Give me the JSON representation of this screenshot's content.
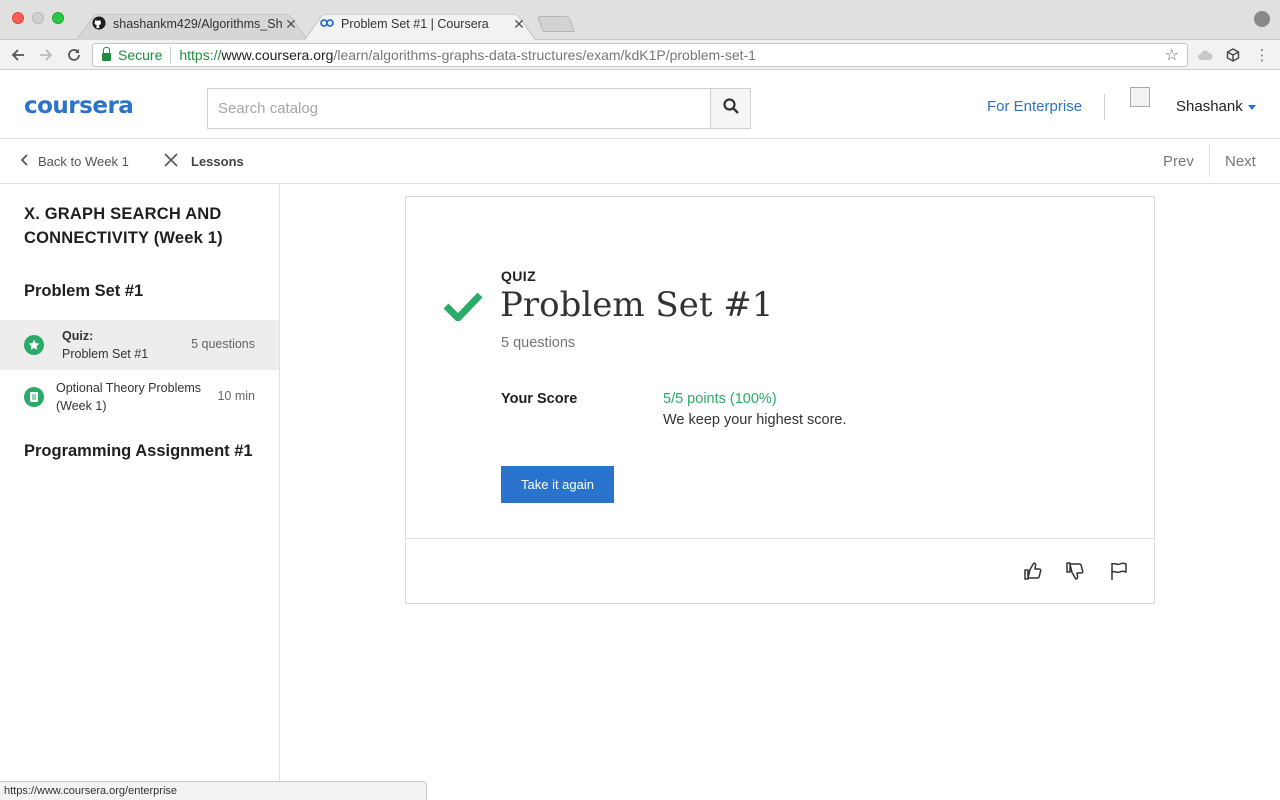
{
  "browser": {
    "tabs": [
      {
        "title": "shashankm429/Algorithms_Sh",
        "active": false
      },
      {
        "title": "Problem Set #1 | Coursera",
        "active": true
      }
    ],
    "address": {
      "secure_label": "Secure",
      "scheme": "https://",
      "domain": "www.coursera.org",
      "path": "/learn/algorithms-graphs-data-structures/exam/kdK1P/problem-set-1"
    },
    "status_url": "https://www.coursera.org/enterprise"
  },
  "header": {
    "logo": "coursera",
    "search_placeholder": "Search catalog",
    "enterprise_link": "For Enterprise",
    "user_name": "Shashank"
  },
  "subnav": {
    "back_label": "Back to Week 1",
    "lessons_label": "Lessons",
    "prev_label": "Prev",
    "next_label": "Next"
  },
  "sidebar": {
    "week_title": "X. GRAPH SEARCH AND CONNECTIVITY (Week 1)",
    "sections": [
      {
        "title": "Problem Set #1"
      },
      {
        "title": "Programming Assignment #1"
      }
    ],
    "items": [
      {
        "type_label": "Quiz:",
        "title": "Problem Set #1",
        "meta": "5 questions",
        "selected": true
      },
      {
        "title_line1": "Optional Theory Problems",
        "title_line2": "(Week 1)",
        "meta": "10 min",
        "selected": false
      }
    ]
  },
  "quiz": {
    "label": "QUIZ",
    "title": "Problem Set #1",
    "subtitle": "5 questions",
    "score_label": "Your Score",
    "score_value": "5/5 points (100%)",
    "score_note": "We keep your highest score.",
    "retake_button": "Take it again"
  },
  "colors": {
    "brand": "#2a73cc",
    "success": "#2aab68"
  }
}
